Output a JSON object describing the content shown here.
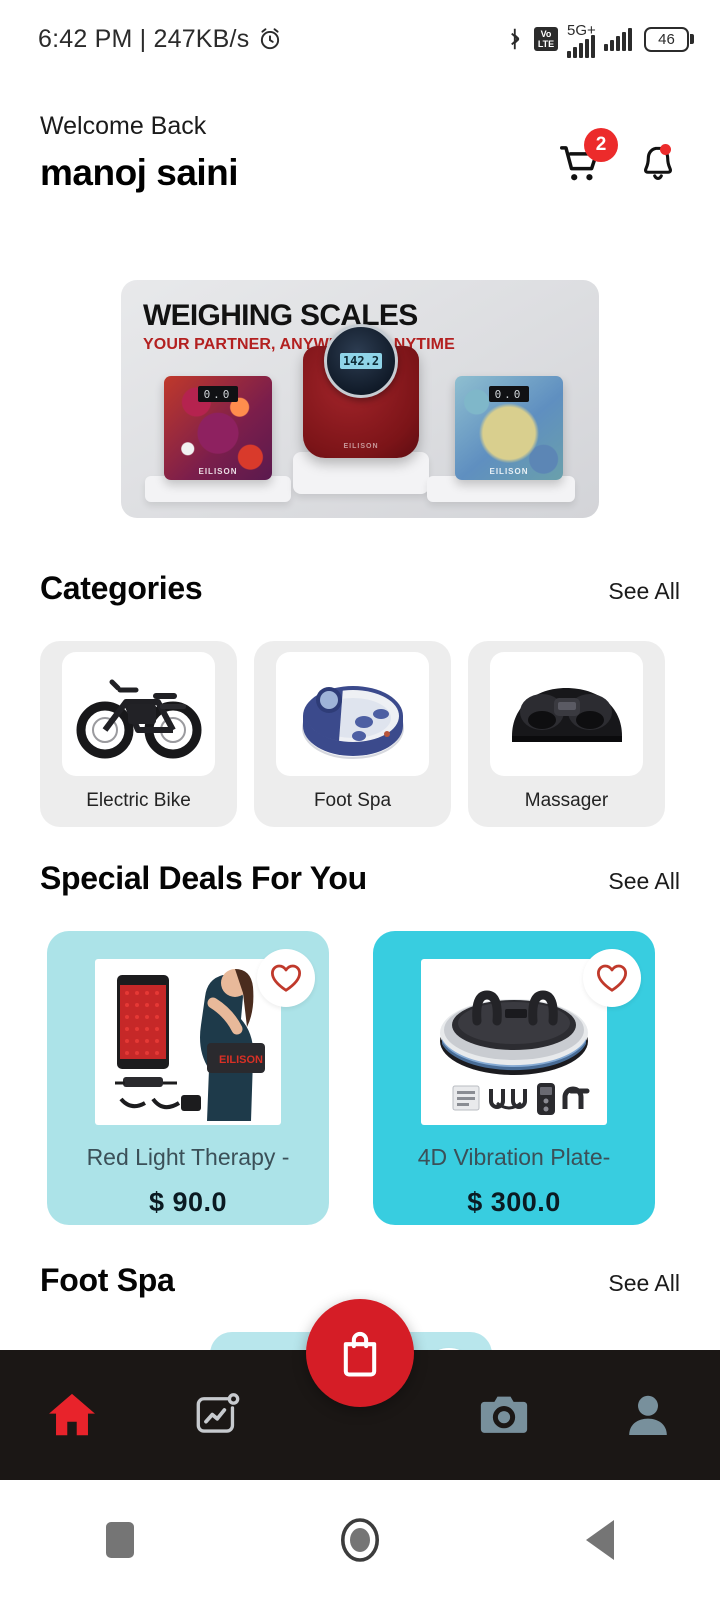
{
  "statusbar": {
    "time_and_speed": "6:42 PM | 247KB/s",
    "alarm_icon": "alarm-clock-icon",
    "bluetooth_icon": "bluetooth-icon",
    "volte_label": "VoLTE",
    "volte_line1": "Vo",
    "volte_line2": "LTE",
    "network_label": "5G+",
    "battery_level": "46"
  },
  "header": {
    "greeting": "Welcome Back",
    "username": "manoj saini",
    "cart_badge": "2",
    "cart_icon": "shopping-cart-icon",
    "bell_icon": "notification-bell-icon"
  },
  "banner": {
    "title": "WEIGHING SCALES",
    "subtitle": "YOUR PARTNER, ANYWHERE, ANYTIME",
    "center_reading": "142.2",
    "left_reading": "0.0",
    "right_reading": "0.0",
    "brand_left": "EILISON",
    "brand_center": "EILISON",
    "brand_right": "EILISON"
  },
  "categories": {
    "title": "Categories",
    "see_all": "See All",
    "items": [
      {
        "label": "Electric Bike",
        "icon": "electric-bike-image"
      },
      {
        "label": "Foot Spa",
        "icon": "foot-spa-image"
      },
      {
        "label": "Massager",
        "icon": "foot-massager-image"
      }
    ]
  },
  "special_deals": {
    "title": "Special Deals For You",
    "see_all": "See All",
    "items": [
      {
        "name": "Red Light Therapy -",
        "price": "$ 90.0",
        "bg_color": "#ace3e8",
        "favorite_icon": "heart-icon",
        "image": "red-light-therapy-belt-image"
      },
      {
        "name": "4D Vibration Plate-",
        "price": "$ 300.0",
        "bg_color": "#38cde0",
        "favorite_icon": "heart-icon",
        "image": "4d-vibration-plate-image"
      }
    ]
  },
  "foot_spa_section": {
    "title": "Foot Spa",
    "see_all": "See All",
    "card_bg_color": "#b8e6ec",
    "favorite_icon": "heart-icon"
  },
  "bottom_nav": {
    "items": [
      {
        "name": "home",
        "icon": "home-icon",
        "active": true
      },
      {
        "name": "analytics",
        "icon": "analytics-chart-icon",
        "active": false
      },
      {
        "name": "camera",
        "icon": "camera-icon",
        "active": false
      },
      {
        "name": "profile",
        "icon": "person-icon",
        "active": false
      }
    ],
    "fab_icon": "shopping-bag-icon",
    "fab_color": "#d51d26",
    "active_color": "#ec2b2b",
    "inactive_color": "#78909c",
    "background": "#1b1715"
  },
  "system_nav": {
    "recents_icon": "square-recents-icon",
    "home_icon": "circle-home-icon",
    "back_icon": "triangle-back-icon"
  }
}
